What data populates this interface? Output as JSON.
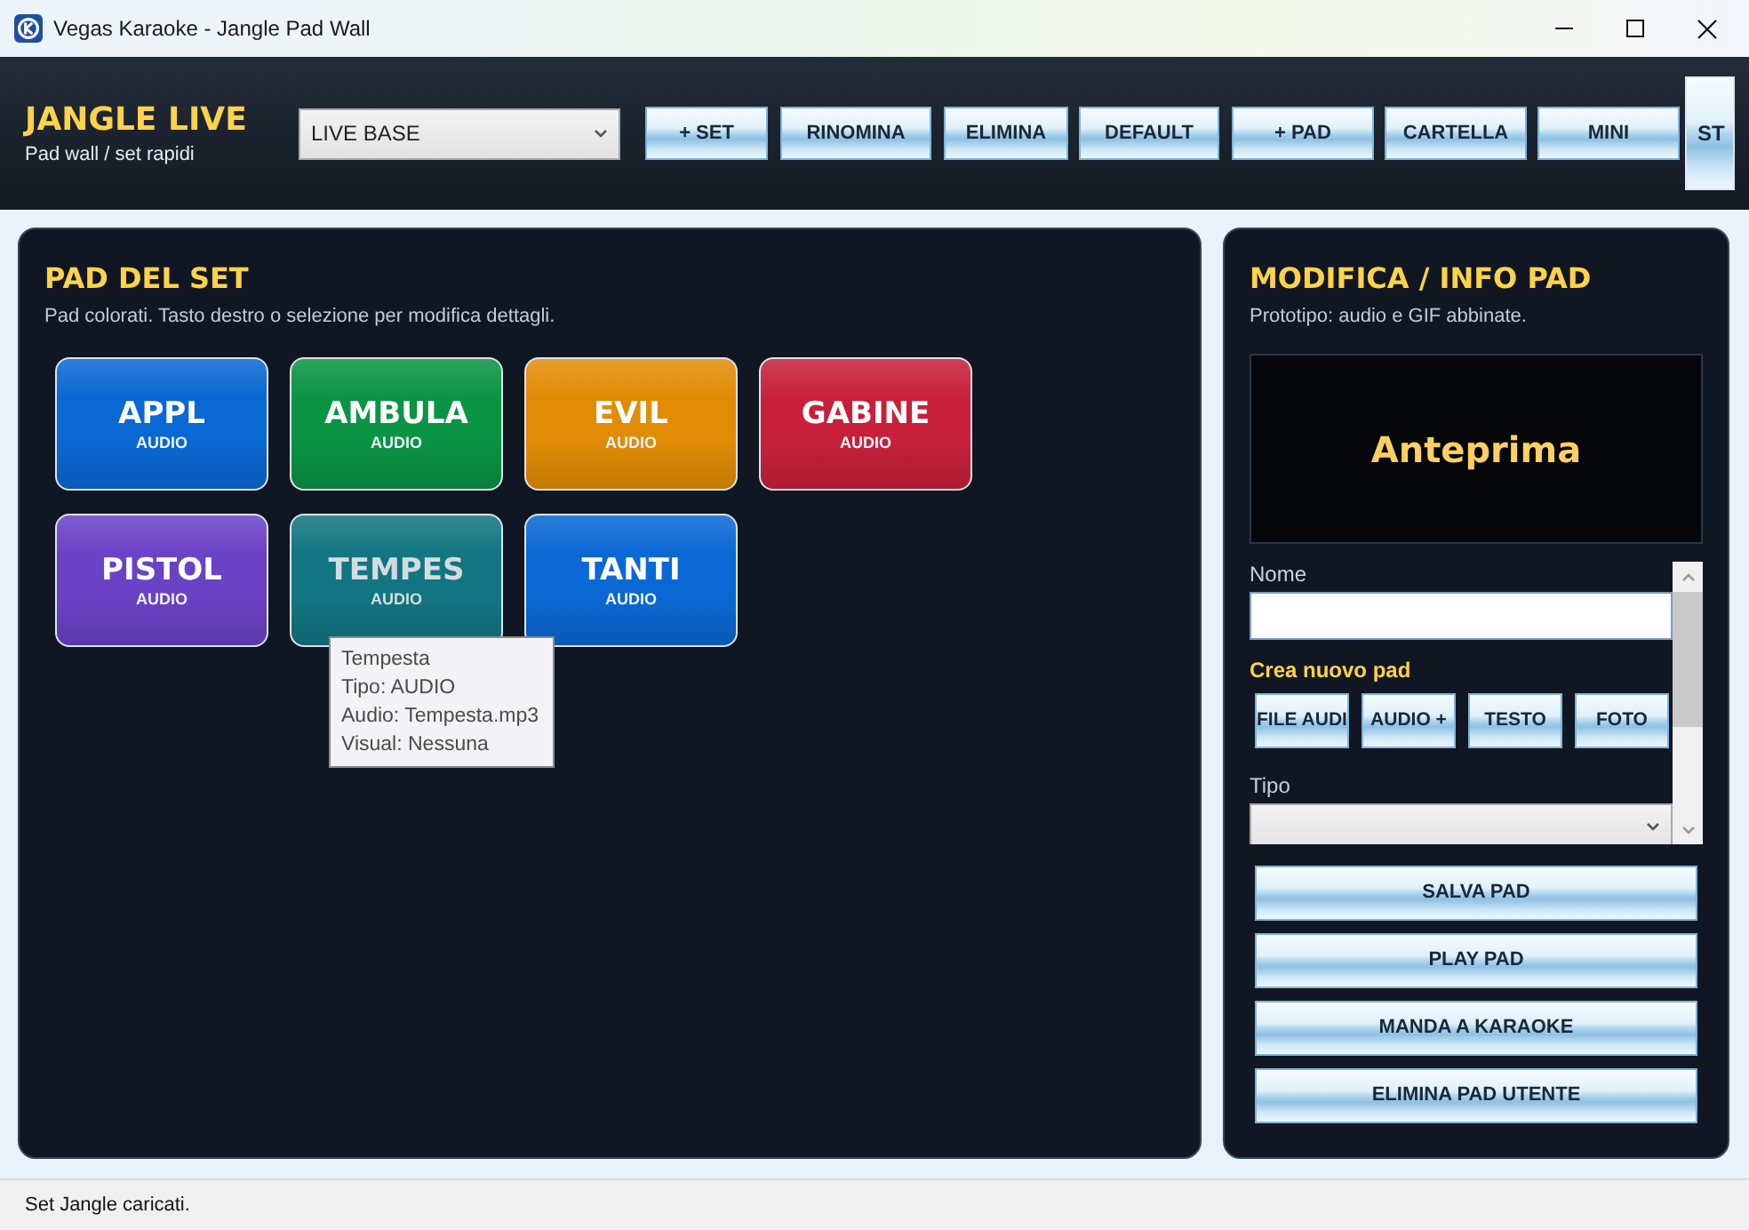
{
  "window": {
    "title": "Vegas Karaoke - Jangle Pad Wall"
  },
  "header": {
    "brand": "JANGLE LIVE",
    "tagline": "Pad wall / set rapidi",
    "set_select": {
      "value": "LIVE BASE"
    },
    "buttons": [
      {
        "label": "+ SET",
        "kind": "standard"
      },
      {
        "label": "RINOMINA",
        "kind": "standard"
      },
      {
        "label": "ELIMINA",
        "kind": "standard"
      },
      {
        "label": "DEFAULT",
        "kind": "standard"
      },
      {
        "label": "+ PAD",
        "kind": "standard"
      },
      {
        "label": "CARTELLA",
        "kind": "standard"
      },
      {
        "label": "MINI",
        "kind": "standard"
      },
      {
        "label": "ST",
        "kind": "tall"
      }
    ]
  },
  "pad_panel": {
    "title": "PAD DEL SET",
    "subtitle": "Pad colorati. Tasto destro o selezione per modifica dettagli.",
    "pads": [
      {
        "name": "APPL",
        "type": "AUDIO",
        "color": "#0a68d4",
        "hovered": false
      },
      {
        "name": "AMBULA",
        "type": "AUDIO",
        "color": "#0a9444",
        "hovered": false
      },
      {
        "name": "EVIL",
        "type": "AUDIO",
        "color": "#e28c05",
        "hovered": false
      },
      {
        "name": "GABINE",
        "type": "AUDIO",
        "color": "#c8203a",
        "hovered": false
      },
      {
        "name": "PISTOL",
        "type": "AUDIO",
        "color": "#6a42c6",
        "hovered": false
      },
      {
        "name": "TEMPES",
        "type": "AUDIO",
        "color": "#127682",
        "hovered": true
      },
      {
        "name": "TANTI",
        "type": "AUDIO",
        "color": "#0a68d4",
        "hovered": false
      }
    ],
    "tooltip": {
      "lines": [
        "Tempesta",
        "Tipo: AUDIO",
        "Audio: Tempesta.mp3",
        "Visual: Nessuna"
      ]
    }
  },
  "info_panel": {
    "title": "MODIFICA / INFO PAD",
    "subtitle": "Prototipo: audio e GIF abbinate.",
    "preview": "Anteprima",
    "form": {
      "name_label": "Nome",
      "create_label": "Crea nuovo pad",
      "create_buttons": [
        "FILE AUDI",
        "AUDIO +",
        "TESTO",
        "FOTO"
      ],
      "type_label": "Tipo"
    },
    "actions": [
      "SALVA PAD",
      "PLAY PAD",
      "MANDA A KARAOKE",
      "ELIMINA PAD UTENTE"
    ]
  },
  "status_bar": {
    "text": "Set Jangle caricati."
  }
}
